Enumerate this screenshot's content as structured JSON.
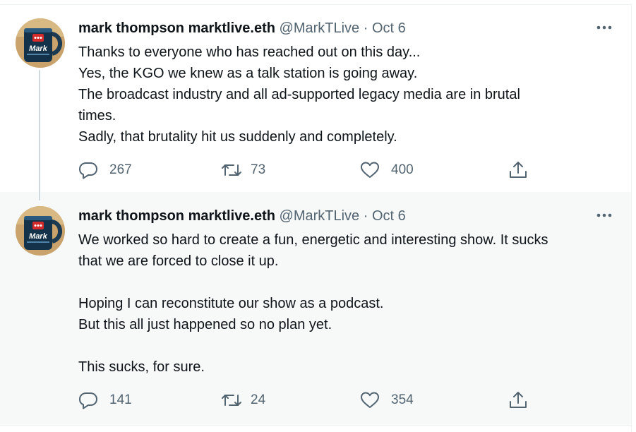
{
  "tweets": [
    {
      "name": "mark thompson marktlive.eth",
      "handle": "@MarkTLive",
      "separator": "·",
      "date": "Oct 6",
      "avatar_text": "Mark",
      "more_label": "•••",
      "lines": [
        "Thanks to everyone who has reached out on this day...",
        "Yes, the KGO we knew as a talk station is going away.",
        "The broadcast industry and all ad-supported legacy media are in brutal",
        "times.",
        "Sadly, that brutality hit us suddenly and completely."
      ],
      "replies": "267",
      "retweets": "73",
      "likes": "400"
    },
    {
      "name": "mark thompson marktlive.eth",
      "handle": "@MarkTLive",
      "separator": "·",
      "date": "Oct 6",
      "avatar_text": "Mark",
      "more_label": "•••",
      "lines": [
        "We worked so hard to create a fun, energetic and interesting show.  It sucks",
        "that we are forced to close it up.",
        "",
        "Hoping I can reconstitute our show as a podcast.",
        "But this all just happened so no plan yet.",
        "",
        "This sucks, for sure."
      ],
      "replies": "141",
      "retweets": "24",
      "likes": "354"
    }
  ],
  "icons": {
    "reply": "speech-bubble",
    "retweet": "retweet-arrows",
    "like": "heart-outline",
    "share": "share-upload"
  },
  "colors": {
    "text": "#0f1419",
    "secondary": "#536471",
    "thread_line": "#cfd9de",
    "hover_background": "#f7f9f9"
  }
}
